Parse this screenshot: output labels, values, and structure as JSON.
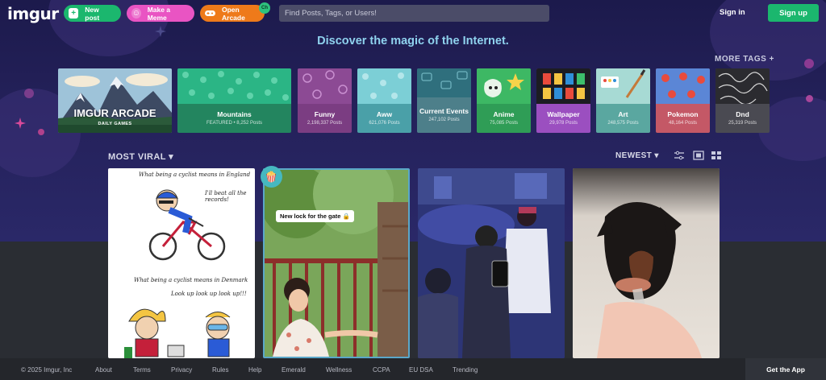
{
  "header": {
    "logo": "imgur",
    "new_post": "New post",
    "make_meme": "Make a Meme",
    "open_arcade": "Open Arcade",
    "arcade_badge": "Ch",
    "search_placeholder": "Find Posts, Tags, or Users!",
    "sign_in": "Sign in",
    "sign_up": "Sign up"
  },
  "hero": {
    "tagline": "Discover the magic of the Internet.",
    "more_tags": "MORE TAGS +"
  },
  "arcade_tile": {
    "title": "IMGUR ARCADE",
    "subtitle": "DAILY GAMES"
  },
  "tags": [
    {
      "name": "Mountains",
      "count": "FEATURED • 8,252 Posts",
      "color": "#23855f"
    },
    {
      "name": "Funny",
      "count": "2,198,337 Posts",
      "color": "#7b3d82"
    },
    {
      "name": "Aww",
      "count": "621,076 Posts",
      "color": "#4aa0a8"
    },
    {
      "name": "Current Events",
      "count": "247,102 Posts",
      "color": "#4d7f8a"
    },
    {
      "name": "Anime",
      "count": "75,085 Posts",
      "color": "#2f9d56"
    },
    {
      "name": "Wallpaper",
      "count": "29,978 Posts",
      "color": "#9b4fc0"
    },
    {
      "name": "Art",
      "count": "248,575 Posts",
      "color": "#5aa7a0"
    },
    {
      "name": "Pokemon",
      "count": "48,164 Posts",
      "color": "#c45866"
    },
    {
      "name": "Dnd",
      "count": "25,319 Posts",
      "color": "#4a4a52"
    }
  ],
  "feed": {
    "section": "MOST VIRAL",
    "sort": "NEWEST",
    "card1_text_top": "What being a cyclist means in England",
    "card1_bubble_top": "I'll beat all the records!",
    "card1_text_mid": "What being a cyclist means in Denmark",
    "card1_bubble_mid": "Look up look up look up!!!",
    "card2_label": "New lock for the gate 🔒"
  },
  "footer": {
    "copyright": "© 2025 Imgur, Inc",
    "links": [
      "About",
      "Terms",
      "Privacy",
      "Rules",
      "Help",
      "Emerald",
      "Wellness",
      "CCPA",
      "EU DSA",
      "Trending"
    ],
    "get_app": "Get the App"
  },
  "colors": {
    "accent_green": "#1bb76e",
    "meme_pink": "#e954c3",
    "arcade_orange": "#ee7a1a",
    "tagline_blue": "#8fd2ee"
  }
}
